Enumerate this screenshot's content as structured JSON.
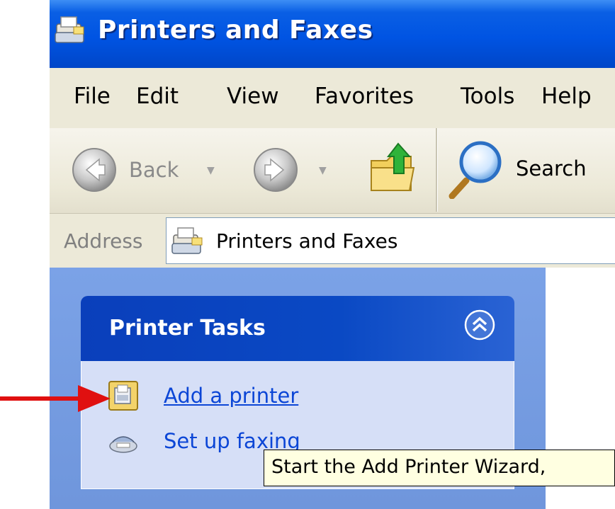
{
  "window": {
    "title": "Printers and Faxes",
    "icon": "printers-folder-icon"
  },
  "menu": {
    "items": [
      "File",
      "Edit",
      "View",
      "Favorites",
      "Tools",
      "Help"
    ]
  },
  "toolbar": {
    "back_label": "Back",
    "search_label": "Search",
    "icons": {
      "back": "back-arrow-icon",
      "forward": "forward-arrow-icon",
      "up": "up-folder-icon",
      "search": "magnifier-icon"
    }
  },
  "address": {
    "label": "Address",
    "value": "Printers and Faxes"
  },
  "tasks": {
    "title": "Printer Tasks",
    "items": [
      {
        "label": "Add a printer",
        "icon": "add-printer-icon"
      },
      {
        "label": "Set up faxing",
        "icon": "fax-icon"
      }
    ]
  },
  "tooltip": {
    "text": "Start the Add Printer Wizard,"
  },
  "colors": {
    "titlebar": "#0054e3",
    "link": "#0c46d6",
    "arrow": "#e01010",
    "pane": "#7ba2e7"
  }
}
